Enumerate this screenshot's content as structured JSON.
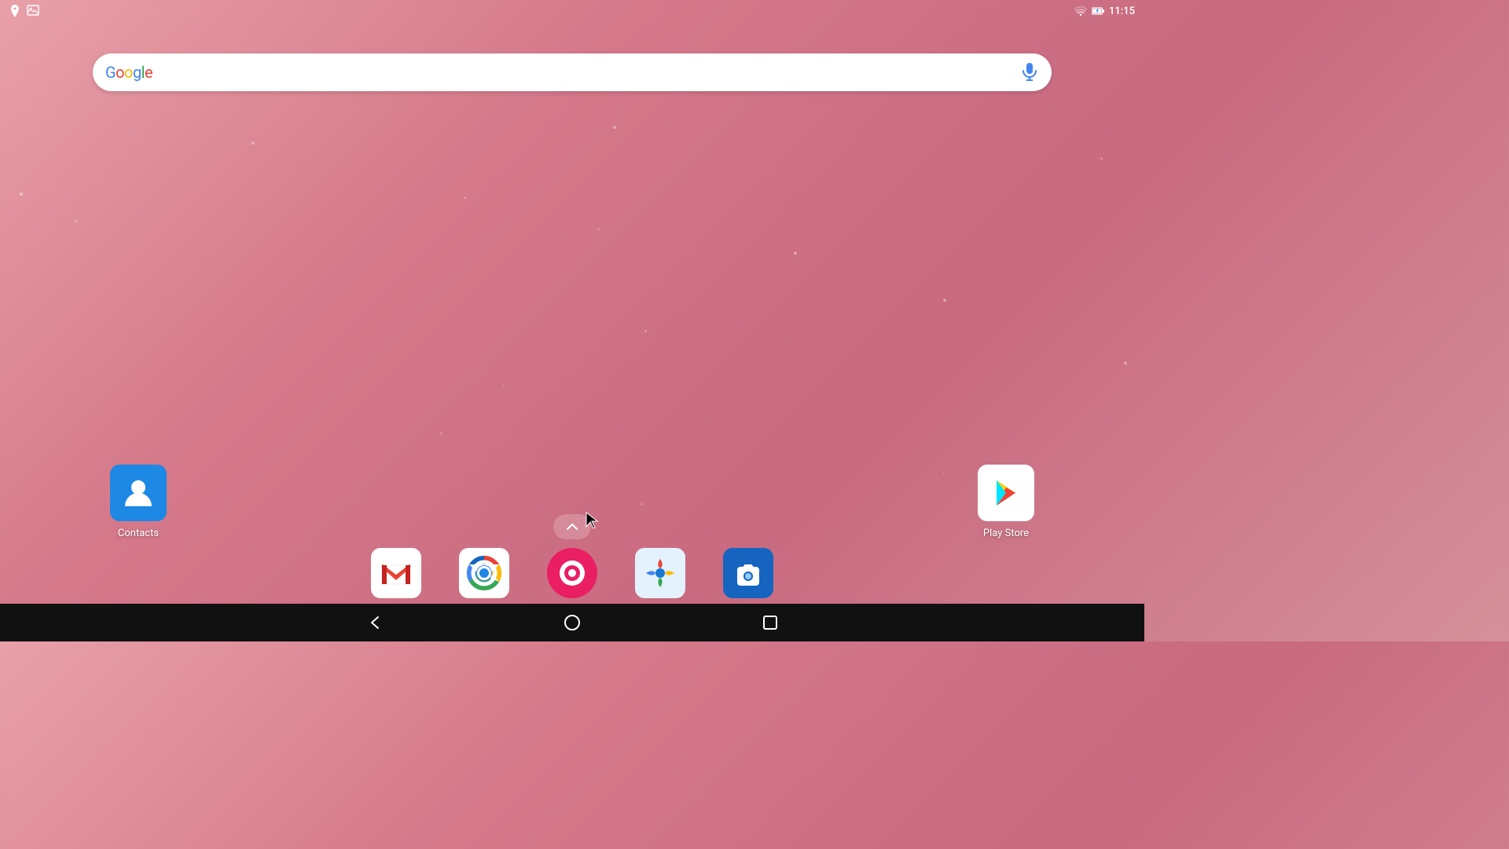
{
  "statusBar": {
    "time": "11:15",
    "leftIcons": [
      "location-icon",
      "image-icon"
    ],
    "rightIcons": [
      "wifi-icon",
      "battery-icon"
    ]
  },
  "searchBar": {
    "placeholder": "Google",
    "googleLogoLetters": [
      "G",
      "o",
      "o",
      "g",
      "l",
      "e"
    ],
    "micLabel": "voice-search"
  },
  "desktopApps": [
    {
      "name": "Contacts",
      "id": "contacts-app"
    },
    {
      "name": "Play Store",
      "id": "play-store-app"
    }
  ],
  "dockApps": [
    {
      "name": "Gmail",
      "id": "gmail-app"
    },
    {
      "name": "Chrome",
      "id": "chrome-app"
    },
    {
      "name": "Musixmatch",
      "id": "music-app"
    },
    {
      "name": "Photos",
      "id": "photos-app"
    },
    {
      "name": "Camera",
      "id": "camera-app"
    }
  ],
  "appDrawer": {
    "label": "App Drawer",
    "chevronUp": "▲"
  },
  "navBar": {
    "back": "◁",
    "home": "○",
    "recents": "□"
  },
  "background": {
    "color1": "#e8a0a8",
    "color2": "#c96a80"
  }
}
